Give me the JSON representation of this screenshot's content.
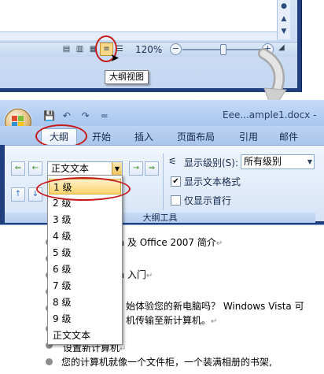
{
  "top": {
    "zoom": "120%",
    "tooltip": "大纲视图",
    "view_buttons": [
      "print-layout",
      "full-screen-reading",
      "web-layout",
      "outline",
      "draft"
    ],
    "active_view": "outline"
  },
  "window": {
    "title": "Eee...ample1.docx -",
    "qat": {
      "save": "💾",
      "undo": "↶",
      "redo": "↷",
      "more": "="
    }
  },
  "tabs": [
    "大纲",
    "开始",
    "插入",
    "页面布局",
    "引用",
    "邮件"
  ],
  "active_tab": "大纲",
  "ribbon": {
    "level_combo_value": "正文文本",
    "show_level_label": "显示级别(S):",
    "show_level_value": "所有级别",
    "show_text_format": "显示文本格式",
    "show_first_line": "仅显示首行",
    "group_label": "大纲工具"
  },
  "dropdown": {
    "items": [
      "1 级",
      "2 级",
      "3 级",
      "4 级",
      "5 级",
      "6 级",
      "7 级",
      "8 级",
      "9 级",
      "正文文本"
    ],
    "highlighted": "1 级"
  },
  "document": {
    "lines": [
      "ta 及 Office 2007 简介",
      "ta 入门",
      "始体验您的新电脑吗？ Windows Vista 可",
      "机传输至新计算机。",
      "设置新计算机",
      "您的计算机就像一个文件柜，一个装满相册的书架,"
    ]
  },
  "colors": {
    "accent_ring": "#c41c1c",
    "ribbon_blue": "#1f3f7f",
    "highlight": "#fbd46f"
  }
}
